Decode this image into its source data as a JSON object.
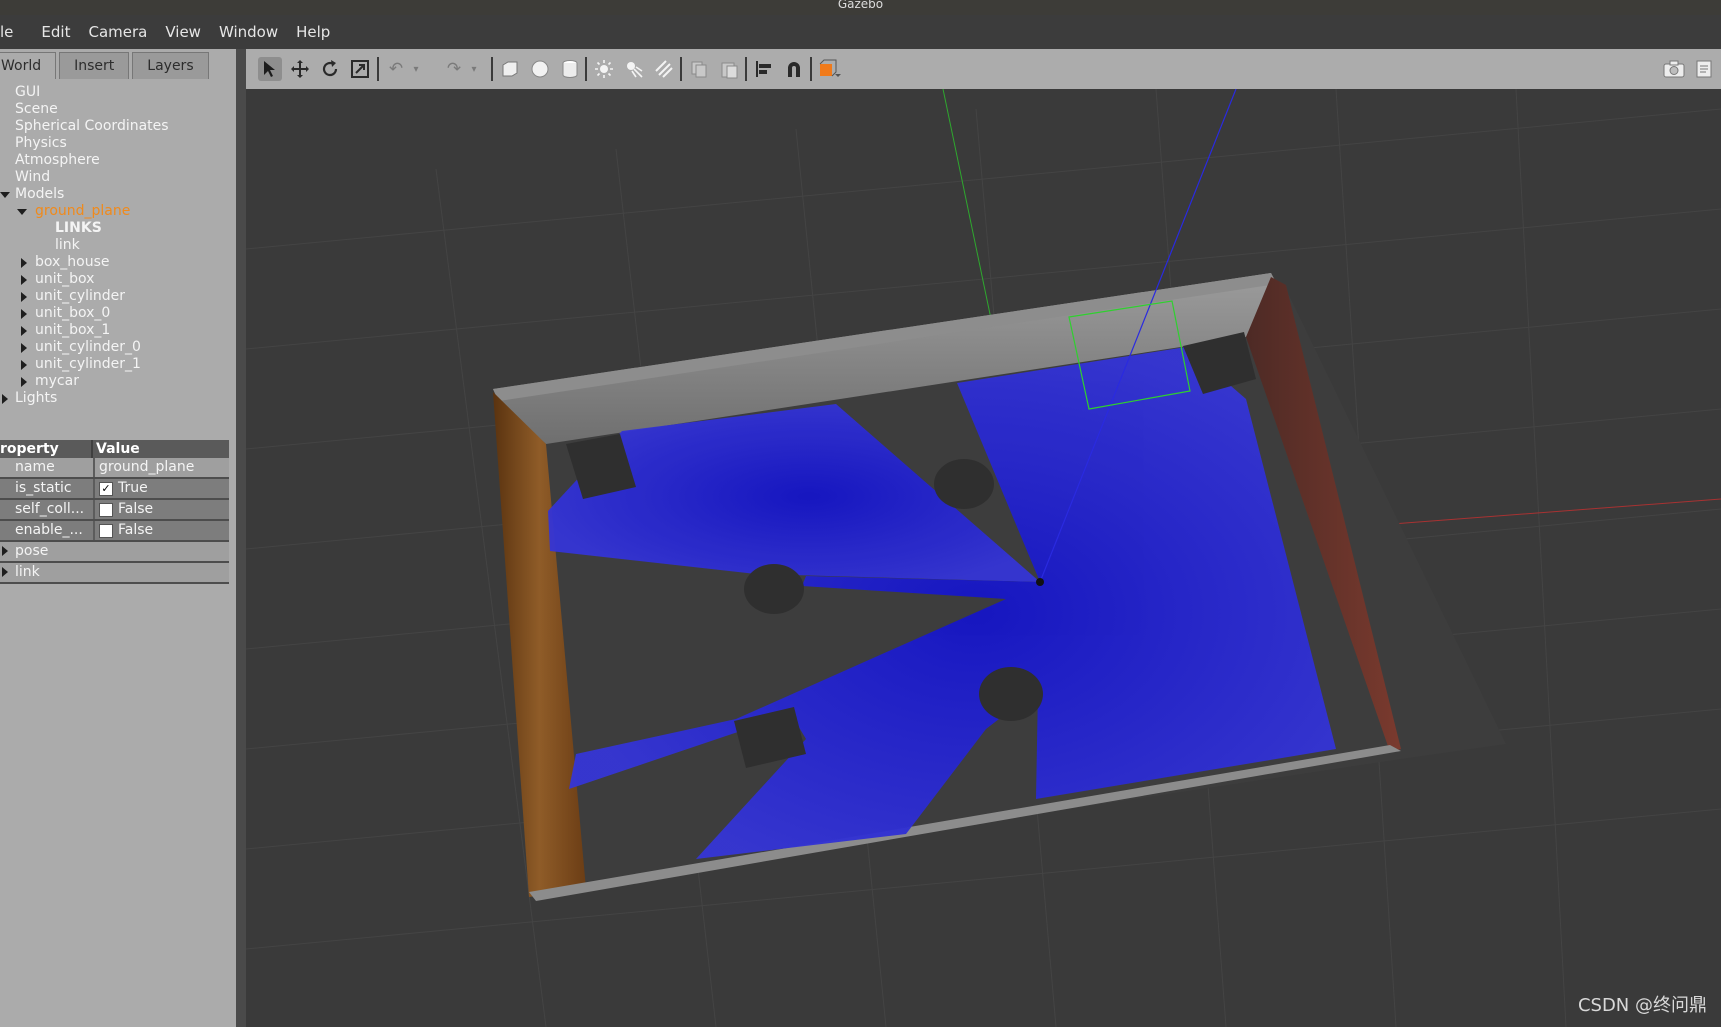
{
  "window": {
    "title": "Gazebo"
  },
  "menu": [
    "le",
    "Edit",
    "Camera",
    "View",
    "Window",
    "Help"
  ],
  "tabs": [
    "World",
    "Insert",
    "Layers"
  ],
  "tree": {
    "items": [
      "GUI",
      "Scene",
      "Spherical Coordinates",
      "Physics",
      "Atmosphere",
      "Wind"
    ],
    "models_label": "Models",
    "ground_plane": "ground_plane",
    "links_label": "LINKS",
    "link_label": "link",
    "models": [
      "box_house",
      "unit_box",
      "unit_cylinder",
      "unit_box_0",
      "unit_box_1",
      "unit_cylinder_0",
      "unit_cylinder_1",
      "mycar"
    ],
    "lights_label": "Lights"
  },
  "properties": {
    "header_key": "roperty",
    "header_val": "Value",
    "rows": [
      {
        "key": "name",
        "value": "ground_plane",
        "checkbox": false
      },
      {
        "key": "is_static",
        "value": "True",
        "checkbox": true,
        "checked": true
      },
      {
        "key": "self_coll...",
        "value": "False",
        "checkbox": true,
        "checked": false
      },
      {
        "key": "enable_...",
        "value": "False",
        "checkbox": true,
        "checked": false
      }
    ],
    "groups": [
      "pose",
      "link"
    ]
  },
  "watermark": "CSDN @终问鼎",
  "colors": {
    "selected": "#f08a1c",
    "laser": "#2b2bd8",
    "panel": "#ababab",
    "toolbar": "#acacac"
  }
}
